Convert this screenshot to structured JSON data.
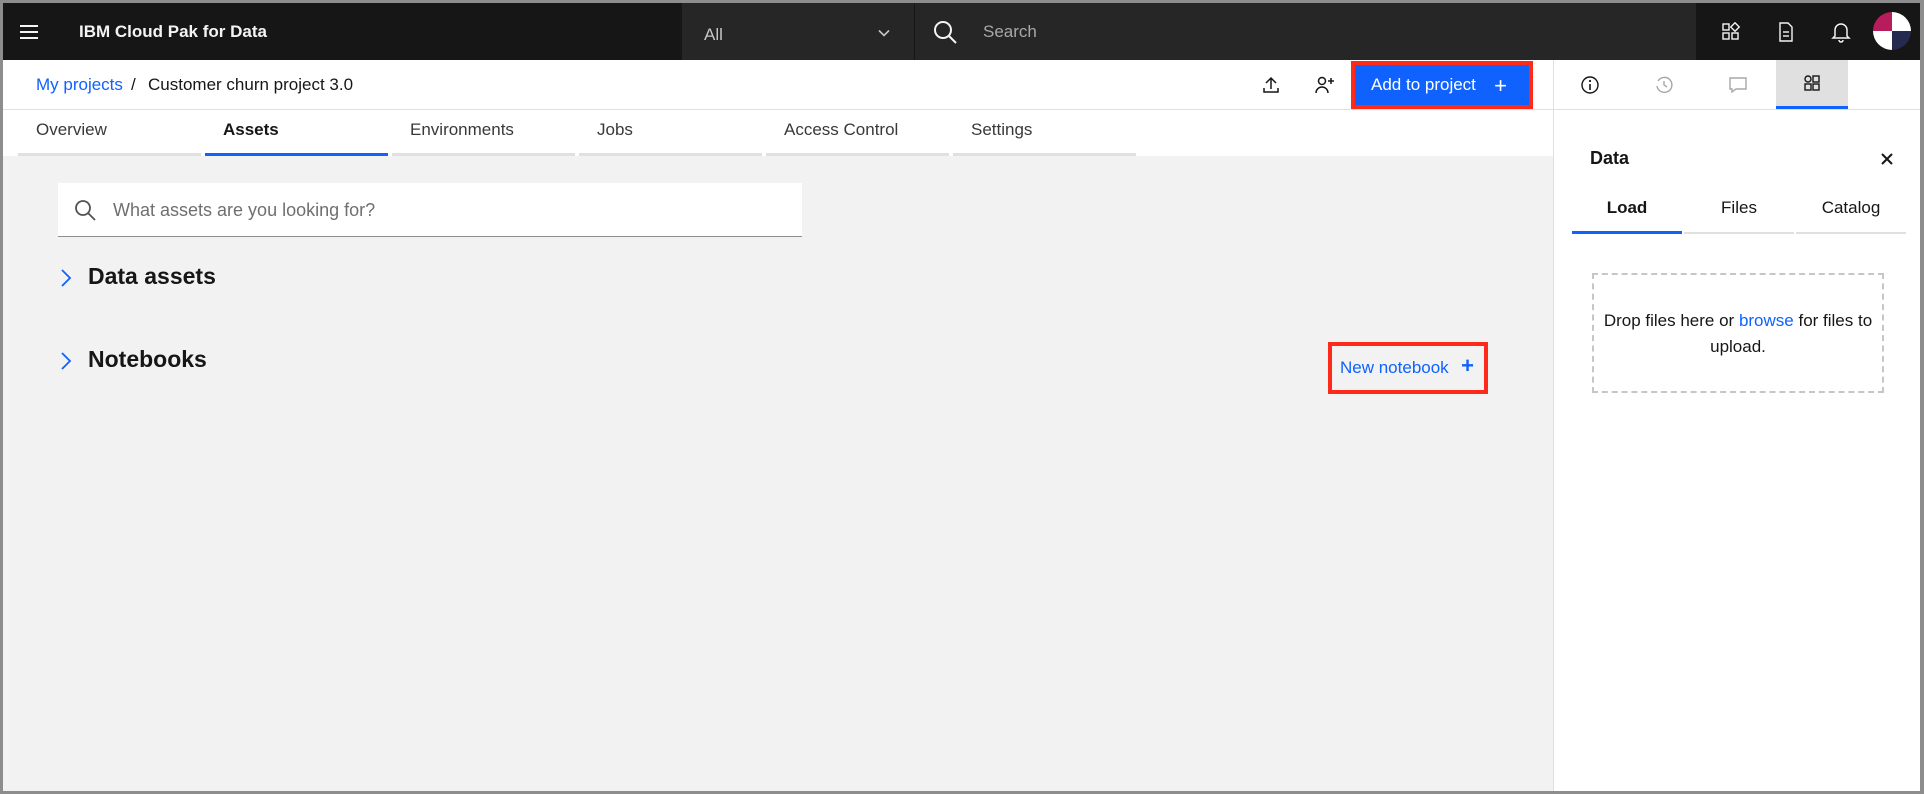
{
  "topbar": {
    "brand": "IBM Cloud Pak for Data",
    "scope_value": "All",
    "search_placeholder": "Search"
  },
  "breadcrumb": {
    "parent": "My projects",
    "separator": "/",
    "current": "Customer churn project 3.0"
  },
  "header": {
    "add_to_project_label": "Add to project",
    "plus": "+"
  },
  "tabs": [
    "Overview",
    "Assets",
    "Environments",
    "Jobs",
    "Access Control",
    "Settings"
  ],
  "active_tab": "Assets",
  "assets": {
    "search_placeholder": "What assets are you looking for?",
    "sections": [
      "Data assets",
      "Notebooks"
    ],
    "new_notebook_label": "New notebook"
  },
  "panel": {
    "title": "Data",
    "tabs": [
      "Load",
      "Files",
      "Catalog"
    ],
    "active_tab": "Load",
    "drop_text_before": "Drop files here or ",
    "drop_link": "browse",
    "drop_text_after": " for files to upload."
  },
  "colors": {
    "accent": "#0f62fe",
    "highlight": "#ff2a1a",
    "topbar": "#161616"
  },
  "icons": {
    "topbar": [
      "menu-icon",
      "chevron-down-icon",
      "search-icon",
      "catalog-icon",
      "document-icon",
      "notification-icon"
    ],
    "header": [
      "upload-icon",
      "add-collaborator-icon"
    ],
    "panel_tabs": [
      "info-icon",
      "history-icon",
      "comment-icon",
      "data-icon"
    ]
  }
}
